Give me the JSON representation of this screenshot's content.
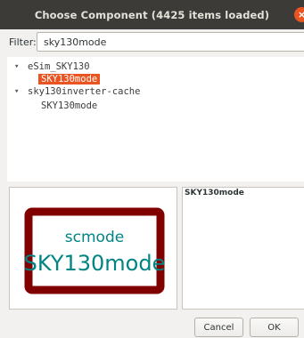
{
  "window": {
    "title": "Choose Component (4425 items loaded)",
    "close_glyph": "×"
  },
  "filter": {
    "label": "Filter:",
    "value": "sky130mode"
  },
  "tree": {
    "items": [
      {
        "label": "eSim_SKY130",
        "expanded": true,
        "level": 0
      },
      {
        "label": "SKY130mode",
        "selected": true,
        "level": 1
      },
      {
        "label": "sky130inverter-cache",
        "expanded": true,
        "level": 0
      },
      {
        "label": "SKY130mode",
        "selected": false,
        "level": 1
      }
    ],
    "expanded_glyph": "▾"
  },
  "preview": {
    "ref_text": "scmode",
    "value_text": "SKY130mode",
    "colors": {
      "border": "#800000",
      "text": "#008484",
      "background": "#ffffff"
    }
  },
  "description": {
    "title": "SKY130mode"
  },
  "buttons": {
    "cancel": "Cancel",
    "ok": "OK"
  },
  "colors": {
    "selection": "#e95420",
    "titlebar": "#3c3b37"
  }
}
